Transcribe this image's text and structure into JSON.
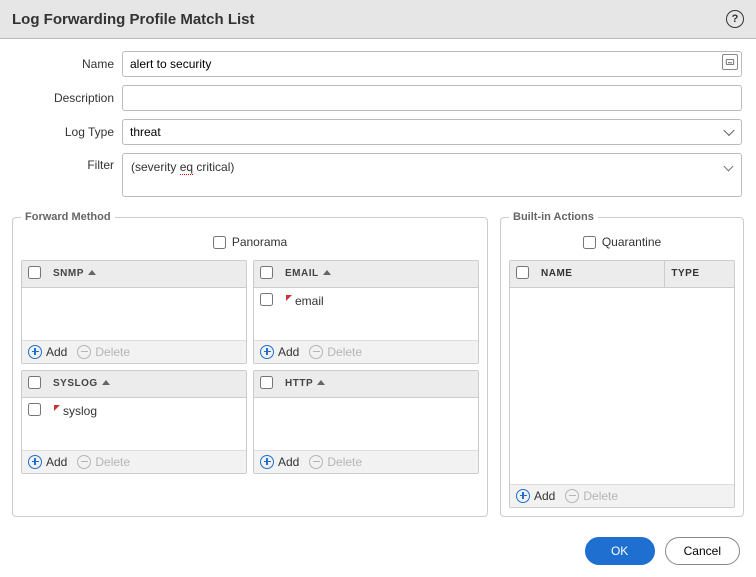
{
  "dialog": {
    "title": "Log Forwarding Profile Match List"
  },
  "form": {
    "name_label": "Name",
    "name_value": "alert to security",
    "description_label": "Description",
    "description_value": "",
    "logtype_label": "Log Type",
    "logtype_value": "threat",
    "filter_label": "Filter",
    "filter_value": "(severity eq critical)"
  },
  "forward": {
    "legend": "Forward Method",
    "panorama_label": "Panorama",
    "panorama_checked": false,
    "boxes": {
      "snmp": {
        "header": "SNMP",
        "items": []
      },
      "email": {
        "header": "EMAIL",
        "items": [
          "email"
        ]
      },
      "syslog": {
        "header": "SYSLOG",
        "items": [
          "syslog"
        ]
      },
      "http": {
        "header": "HTTP",
        "items": []
      }
    },
    "add_label": "Add",
    "delete_label": "Delete"
  },
  "builtin": {
    "legend": "Built-in Actions",
    "quarantine_label": "Quarantine",
    "quarantine_checked": false,
    "cols": {
      "name": "NAME",
      "type": "TYPE"
    },
    "rows": [],
    "add_label": "Add",
    "delete_label": "Delete"
  },
  "footer": {
    "ok": "OK",
    "cancel": "Cancel"
  }
}
